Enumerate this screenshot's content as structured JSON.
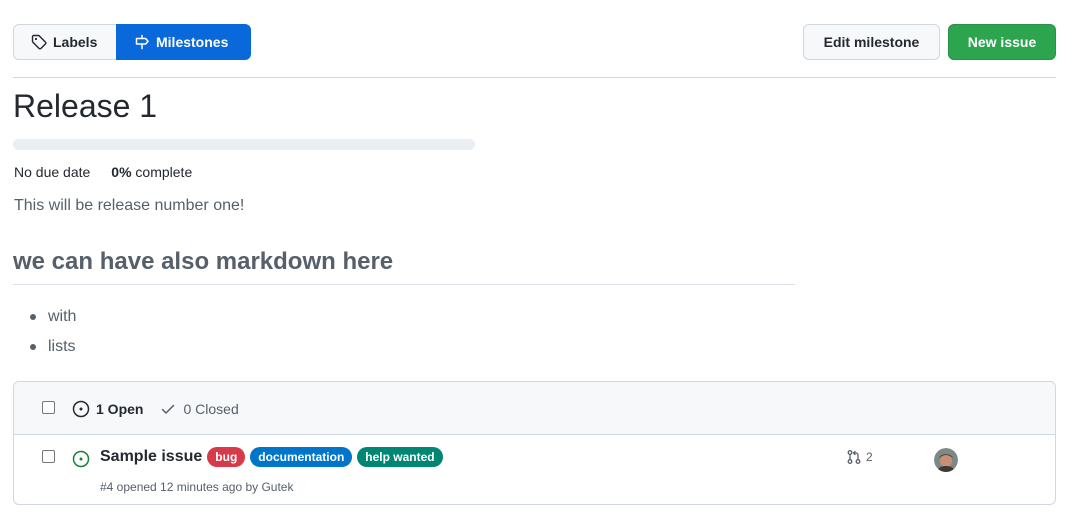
{
  "subnav": {
    "labels": "Labels",
    "milestones": "Milestones"
  },
  "actions": {
    "edit_milestone": "Edit milestone",
    "new_issue": "New issue"
  },
  "milestone": {
    "title": "Release 1",
    "progress_fraction": 0.0,
    "due": "No due date",
    "percent": "0%",
    "percent_suffix": "complete",
    "description": "This will be release number one!",
    "heading": "we can have also markdown here",
    "list": [
      "with",
      "lists"
    ]
  },
  "issues": {
    "open_label": "1 Open",
    "closed_label": "0 Closed",
    "rows": [
      {
        "title": "Sample issue",
        "labels": [
          {
            "name": "bug",
            "bg": "#d73a4a",
            "fg": "#ffffff"
          },
          {
            "name": "documentation",
            "bg": "#0075ca",
            "fg": "#ffffff"
          },
          {
            "name": "help wanted",
            "bg": "#008672",
            "fg": "#ffffff"
          }
        ],
        "subtitle": "#4 opened 12 minutes ago by Gutek",
        "linked_prs": "2",
        "avatar_icon": "user-avatar"
      }
    ]
  },
  "colors": {
    "accent": "#0969da",
    "primary": "#2da44e",
    "open_icon": "#1a7f37"
  }
}
